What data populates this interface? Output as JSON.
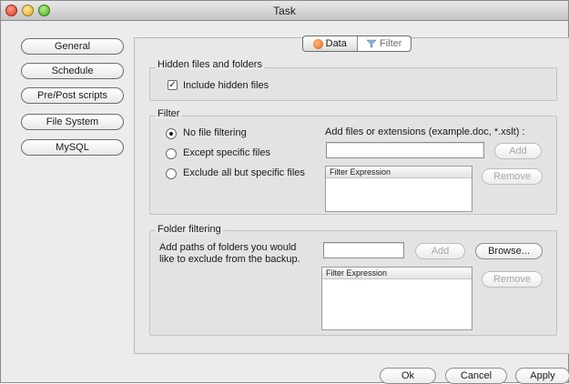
{
  "window": {
    "title": "Task"
  },
  "sidebar": {
    "items": [
      {
        "label": "General"
      },
      {
        "label": "Schedule"
      },
      {
        "label": "Pre/Post scripts"
      },
      {
        "label": "File System"
      },
      {
        "label": "MySQL"
      }
    ]
  },
  "tabs": [
    {
      "label": "Data",
      "active": true
    },
    {
      "label": "Filter",
      "active": false
    }
  ],
  "hidden_files": {
    "group_title": "Hidden files and folders",
    "checkbox_label": "Include hidden files",
    "checked": true
  },
  "filter": {
    "group_title": "Filter",
    "options": [
      {
        "label": "No file filtering",
        "selected": true
      },
      {
        "label": "Except specific files",
        "selected": false
      },
      {
        "label": "Exclude all but specific files",
        "selected": false
      }
    ],
    "add_label": "Add files or extensions (example.doc, *.xslt) :",
    "input_value": "",
    "add_button": "Add",
    "list_header": "Filter Expression",
    "remove_button": "Remove"
  },
  "folder_filtering": {
    "group_title": "Folder filtering",
    "description_line1": "Add paths of folders you would",
    "description_line2": "like to exclude from the backup.",
    "input_value": "",
    "add_button": "Add",
    "browse_button": "Browse...",
    "list_header": "Filter Expression",
    "remove_button": "Remove"
  },
  "footer": {
    "ok": "Ok",
    "cancel": "Cancel",
    "apply": "Apply"
  }
}
